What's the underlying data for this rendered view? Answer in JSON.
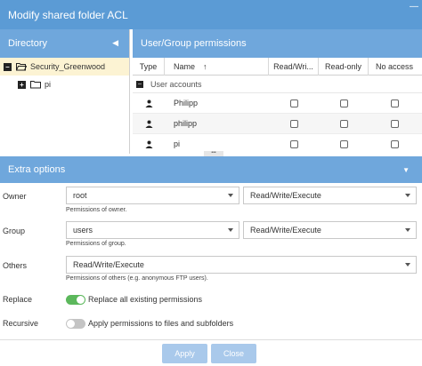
{
  "window": {
    "title": "Modify shared folder ACL"
  },
  "directory": {
    "header": "Directory",
    "items": [
      {
        "label": "Security_Greenwood",
        "expanded": true,
        "selected": true
      },
      {
        "label": "pi",
        "expanded": false,
        "selected": false
      }
    ]
  },
  "permissions": {
    "header": "User/Group permissions",
    "columns": {
      "type": "Type",
      "name": "Name",
      "sort_glyph": "↑",
      "rw": "Read/Wri...",
      "ro": "Read-only",
      "na": "No access"
    },
    "group_label": "User accounts",
    "rows": [
      {
        "name": "Philipp",
        "icon": "user-icon"
      },
      {
        "name": "philipp",
        "icon": "user-icon"
      },
      {
        "name": "pi",
        "icon": "user-icon"
      }
    ]
  },
  "extra": {
    "header": "Extra options",
    "owner": {
      "label": "Owner",
      "user": "root",
      "permission": "Read/Write/Execute",
      "hint": "Permissions of owner."
    },
    "group": {
      "label": "Group",
      "name": "users",
      "permission": "Read/Write/Execute",
      "hint": "Permissions of group."
    },
    "others": {
      "label": "Others",
      "permission": "Read/Write/Execute",
      "hint": "Permissions of others (e.g. anonymous FTP users)."
    },
    "replace": {
      "label": "Replace",
      "text": "Replace all existing permissions",
      "on": true
    },
    "recursive": {
      "label": "Recursive",
      "text": "Apply permissions to files and subfolders",
      "on": false
    }
  },
  "buttons": {
    "apply": "Apply",
    "close": "Close"
  },
  "colors": {
    "titlebar": "#5b9bd5",
    "header": "#6fa7dc",
    "selected_row": "#fcf3d3",
    "switch_on": "#5cb85c",
    "button": "#a9c9eb"
  }
}
